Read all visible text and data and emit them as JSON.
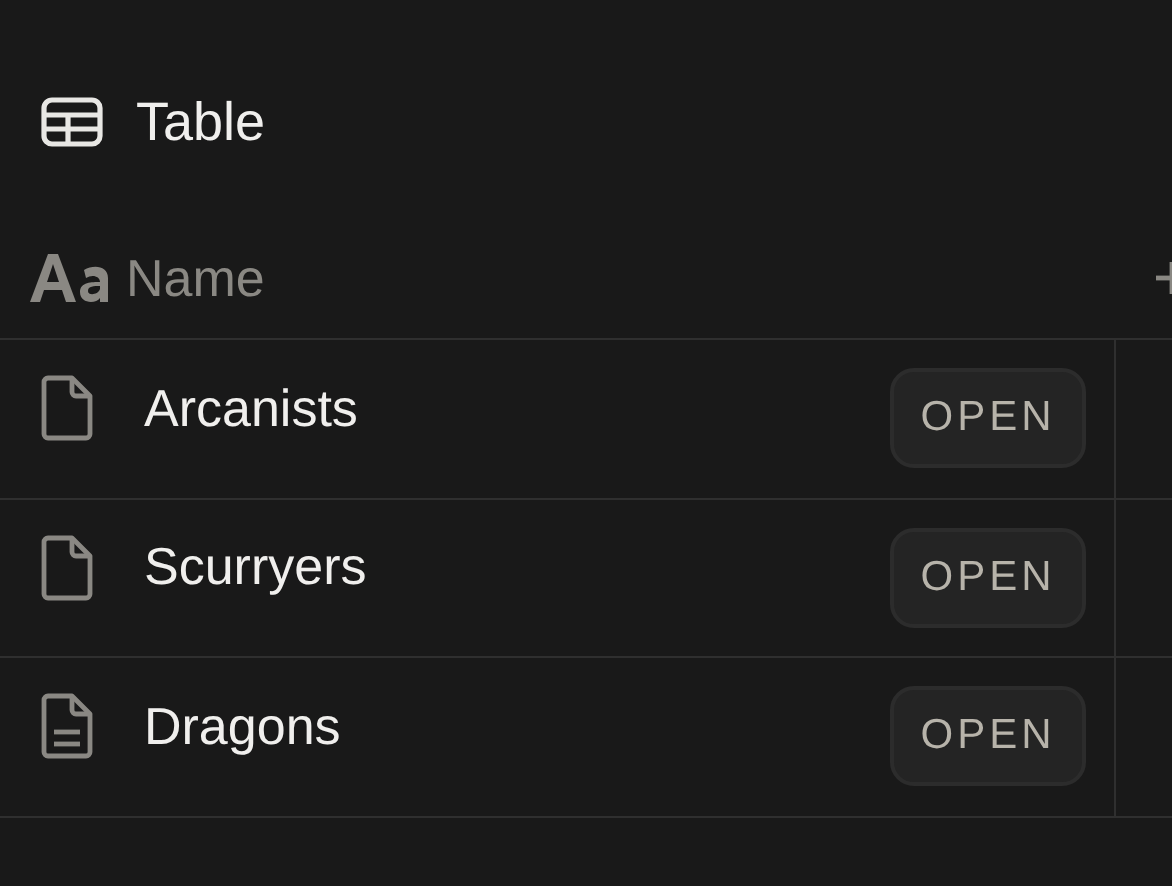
{
  "view": {
    "title": "Table"
  },
  "table": {
    "columns": [
      {
        "label": "Name"
      }
    ],
    "rows": [
      {
        "name": "Arcanists",
        "kind": "empty",
        "action": "OPEN"
      },
      {
        "name": "Scurryers",
        "kind": "empty",
        "action": "OPEN"
      },
      {
        "name": "Dragons",
        "kind": "content",
        "action": "OPEN"
      }
    ]
  }
}
